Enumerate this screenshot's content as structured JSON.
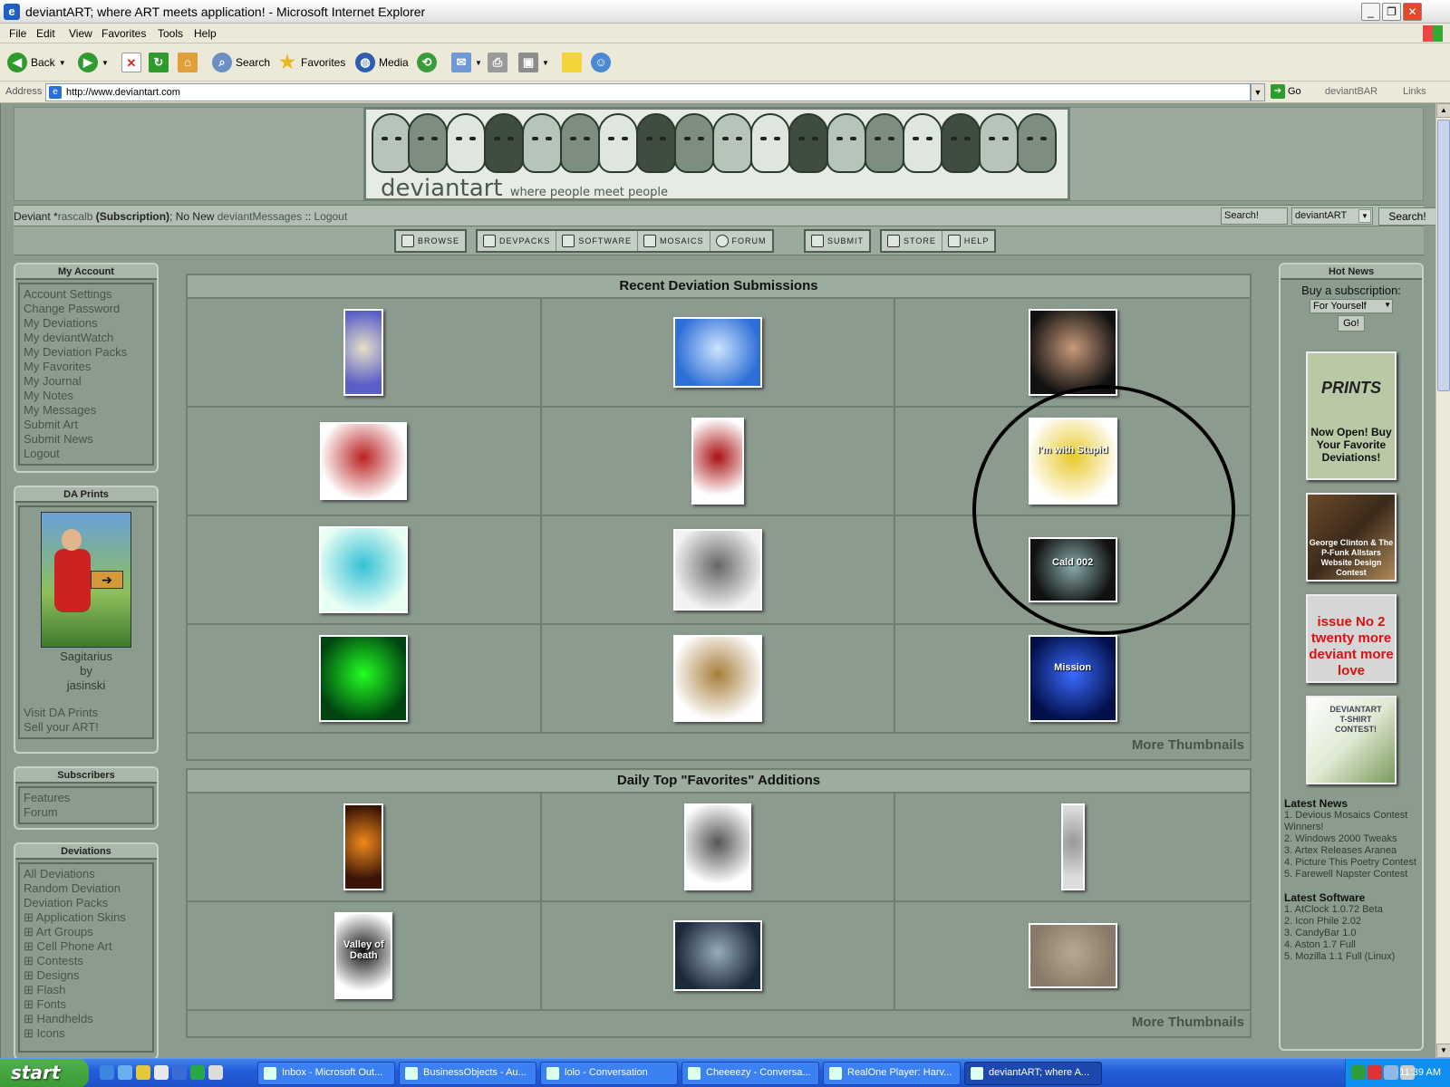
{
  "window": {
    "title": "deviantART; where ART meets application! - Microsoft Internet Explorer",
    "controls": [
      "_",
      "❐",
      "✕"
    ]
  },
  "menu": [
    "File",
    "Edit",
    "View",
    "Favorites",
    "Tools",
    "Help"
  ],
  "toolbar": {
    "back": "Back",
    "search": "Search",
    "favorites": "Favorites",
    "media": "Media"
  },
  "address": {
    "label": "Address",
    "url": "http://www.deviantart.com",
    "go": "Go",
    "devbar": "deviantBAR",
    "links": "Links"
  },
  "banner": {
    "logo": "deviantart",
    "tagline": "where people meet people"
  },
  "userbar": {
    "prefix": "Deviant *",
    "username": "rascalb",
    "status": " (Subscription)",
    "mid": "; No New ",
    "messages": "deviantMessages",
    "sep": " :: ",
    "logout": "Logout",
    "search_value": "Search!",
    "search_scope": "deviantART",
    "search_button": "Search!"
  },
  "nav": [
    {
      "label": "BROWSE"
    },
    {
      "label": "DEVPACKS"
    },
    {
      "label": "SOFTWARE"
    },
    {
      "label": "MOSAICS"
    },
    {
      "label": "FORUM"
    },
    {
      "label": "SUBMIT"
    },
    {
      "label": "STORE"
    },
    {
      "label": "HELP"
    }
  ],
  "left": {
    "my_account": {
      "title": "My Account",
      "links": [
        "Account Settings",
        "Change Password",
        "My Deviations",
        "My deviantWatch",
        "My Deviation Packs",
        "My Favorites",
        "My Journal",
        "My Notes",
        "My Messages",
        "Submit Art",
        "Submit News",
        "Logout"
      ]
    },
    "da_prints": {
      "title": "DA Prints",
      "art_title": "Sagitarius",
      "by": "by",
      "artist": "jasinski",
      "links": [
        "Visit DA Prints",
        "Sell your ART!"
      ]
    },
    "subscribers": {
      "title": "Subscribers",
      "links": [
        "Features",
        "Forum"
      ]
    },
    "deviations": {
      "title": "Deviations",
      "links": [
        "All Deviations",
        "Random Deviation",
        "Deviation Packs"
      ],
      "categories": [
        "Application Skins",
        "Art Groups",
        "Cell Phone Art",
        "Contests",
        "Designs",
        "Flash",
        "Fonts",
        "Handhelds",
        "Icons"
      ]
    }
  },
  "recent": {
    "title": "Recent Deviation Submissions",
    "more": "More Thumbnails",
    "thumbs": [
      {
        "w": 44,
        "h": 96,
        "c1": "#5a5fc8",
        "c2": "#e6e0c8"
      },
      {
        "w": 98,
        "h": 78,
        "c1": "#2d6fd6",
        "c2": "#cfe4ff"
      },
      {
        "w": 98,
        "h": 96,
        "c1": "#111",
        "c2": "#c89a7a"
      },
      {
        "w": 96,
        "h": 86,
        "c1": "#fff",
        "c2": "#b22"
      },
      {
        "w": 58,
        "h": 96,
        "c1": "#fff",
        "c2": "#a11"
      },
      {
        "w": 98,
        "h": 96,
        "c1": "#fff",
        "c2": "#e9c92b",
        "text": "I'm with Stupid"
      },
      {
        "w": 98,
        "h": 96,
        "c1": "#e8fff4",
        "c2": "#36c1d6"
      },
      {
        "w": 98,
        "h": 90,
        "c1": "#f2f2f2",
        "c2": "#666"
      },
      {
        "w": 98,
        "h": 72,
        "c1": "#111",
        "c2": "#8aa",
        "text": "Cald 002"
      },
      {
        "w": 98,
        "h": 96,
        "c1": "#041",
        "c2": "#2f2"
      },
      {
        "w": 98,
        "h": 96,
        "c1": "#fff",
        "c2": "#a77d3a"
      },
      {
        "w": 98,
        "h": 96,
        "c1": "#02104a",
        "c2": "#3a6bff",
        "text": "Mission"
      }
    ]
  },
  "daily": {
    "title": "Daily Top \"Favorites\" Additions",
    "more": "More Thumbnails",
    "thumbs": [
      {
        "w": 44,
        "h": 96,
        "c1": "#3a1406",
        "c2": "#f08a1c"
      },
      {
        "w": 74,
        "h": 96,
        "c1": "#fff",
        "c2": "#555"
      },
      {
        "w": 26,
        "h": 96,
        "c1": "#ddd",
        "c2": "#999"
      },
      {
        "w": 64,
        "h": 96,
        "c1": "#fff",
        "c2": "#111",
        "text": "Valley of Death"
      },
      {
        "w": 98,
        "h": 78,
        "c1": "#1a2a3a",
        "c2": "#9ab"
      },
      {
        "w": 98,
        "h": 72,
        "c1": "#887a66",
        "c2": "#b7a992"
      }
    ]
  },
  "right": {
    "hot_news": {
      "title": "Hot News",
      "buy": "Buy a subscription:",
      "select": "For Yourself",
      "go": "Go!"
    },
    "ads": [
      {
        "label": "Now Open! Buy Your Favorite Deviations!",
        "logo": "PRINTS"
      },
      {
        "label": "George Clinton & The P-Funk Allstars Website Design Contest"
      },
      {
        "label": "issue No 2 twenty more deviant more love"
      },
      {
        "label": "DEVIANTART T-SHIRT CONTEST!"
      }
    ],
    "latest_news": {
      "title": "Latest News",
      "items": [
        "1. Devious Mosaics Contest Winners!",
        "2. Windows 2000 Tweaks",
        "3. Artex Releases Aranea",
        "4. Picture This Poetry Contest",
        "5. Farewell Napster Contest"
      ]
    },
    "latest_software": {
      "title": "Latest Software",
      "items": [
        "1. AtClock 1.0.72 Beta",
        "2. Icon Phile 2.02",
        "3. CandyBar 1.0",
        "4. Aston 1.7 Full",
        "5. Mozilla 1.1 Full (Linux)"
      ]
    }
  },
  "taskbar": {
    "start": "start",
    "tasks": [
      "Inbox - Microsoft Out...",
      "BusinessObjects - Au...",
      "lolo - Conversation",
      "Cheeeezy - Conversa...",
      "RealOne Player: Harv...",
      "deviantART; where A..."
    ],
    "clock": "11:39 AM"
  }
}
